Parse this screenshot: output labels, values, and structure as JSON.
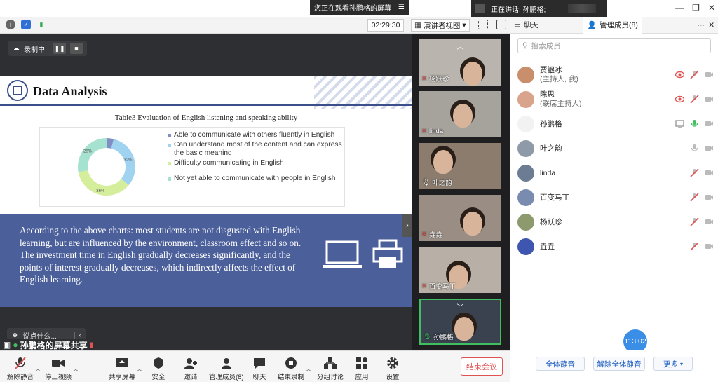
{
  "titlebar": {
    "view_banner": "您正在观看孙鹏格的屏幕",
    "speaking_banner": "正在讲话: 孙鹏格;"
  },
  "toolbar": {
    "timer": "02:29:30",
    "presenter_view": "演讲者视图"
  },
  "right_tabs": {
    "chat": "聊天",
    "members": "管理成员(8)"
  },
  "recording": {
    "label": "录制中"
  },
  "slide": {
    "title": "Data Analysis",
    "table_caption": "Table3 Evaluation of English listening and speaking ability",
    "paragraph": "According to the above charts: most students are not disgusted with English learning, but are influenced by the environment, classroom effect and so on. The investment time in English gradually decreases significantly, and the points of interest gradually decreases, which indirectly affects the effect of English learning."
  },
  "chart_data": {
    "type": "pie",
    "donut": true,
    "categories": [
      "Able to communicate with others fluently in English",
      "Can understand most of the content and can express the basic meaning",
      "Difficulty communicating in English",
      "Not yet able to communicate with people in English"
    ],
    "values": [
      4,
      32,
      36,
      28
    ],
    "value_labels": [
      "",
      "32%",
      "36%",
      "28%"
    ],
    "colors": [
      "#7f8fc4",
      "#9fd3ef",
      "#d5ee9b",
      "#a6e2d0"
    ],
    "legend_position": "right"
  },
  "chat_input": {
    "placeholder": "说点什么..."
  },
  "share": {
    "label": "孙鹏格的屏幕共享"
  },
  "videos": [
    {
      "name": "杨跃珍"
    },
    {
      "name": "linda"
    },
    {
      "name": "叶之韵"
    },
    {
      "name": "垚垚"
    },
    {
      "name": "百变马丁"
    },
    {
      "name": "孙鹏格"
    }
  ],
  "members_panel": {
    "search_placeholder": "搜索成员",
    "members": [
      {
        "name": "贾银冰",
        "role": "(主持人, 我)"
      },
      {
        "name": "陈思",
        "role": "(联席主持人)"
      },
      {
        "name": "孙鹏格",
        "role": ""
      },
      {
        "name": "叶之韵",
        "role": ""
      },
      {
        "name": "linda",
        "role": ""
      },
      {
        "name": "百变马丁",
        "role": ""
      },
      {
        "name": "杨跃珍",
        "role": ""
      },
      {
        "name": "垚垚",
        "role": ""
      }
    ],
    "timer": "113:02",
    "mute_all": "全体静音",
    "unmute_all": "解除全体静音",
    "more": "更多"
  },
  "bottombar": {
    "unmute": "解除静音",
    "stop_video": "停止视频",
    "share_screen": "共享屏幕",
    "security": "安全",
    "invite": "邀请",
    "manage_members": "管理成员(8)",
    "chat": "聊天",
    "end_recording": "结束录制",
    "breakout": "分组讨论",
    "apps": "应用",
    "settings": "设置",
    "end_meeting": "结束会议"
  }
}
